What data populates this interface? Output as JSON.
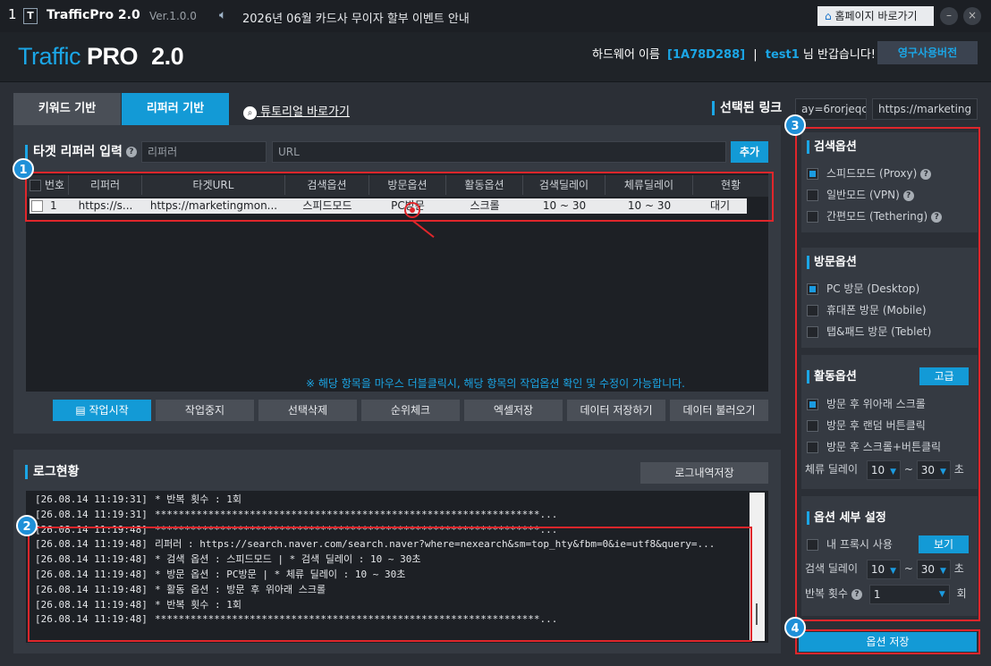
{
  "window": {
    "number": "1",
    "app_name": "TrafficPro 2.0",
    "version": "Ver.1.0.0",
    "notice": "2026년 06월 카드사 무이자 할부 이벤트 안내",
    "home_button": "홈페이지 바로가기"
  },
  "header": {
    "logo_traffic": "Traffic",
    "logo_pro": "PRO",
    "logo_ver": "2.0",
    "hw_label": "하드웨어 이름",
    "hw_id": "[1A78D288]",
    "sep": "|",
    "user": "test1",
    "greet": "님 반갑습니다!",
    "license_button": "영구사용버전"
  },
  "tabs": {
    "keyword": "키워드 기반",
    "referrer": "리퍼러 기반",
    "tutorial": "튜토리얼 바로가기"
  },
  "selected_link": {
    "label": "선택된 링크",
    "field1": "ay=6rorjeqc",
    "field2": "https://marketing"
  },
  "target": {
    "label": "타겟 리퍼러 입력",
    "ref_placeholder": "리퍼러",
    "url_placeholder": "URL",
    "add_button": "추가"
  },
  "table": {
    "headers": [
      "번호",
      "리퍼러",
      "타겟URL",
      "검색옵션",
      "방문옵션",
      "활동옵션",
      "검색딜레이",
      "체류딜레이",
      "현황"
    ],
    "rows": [
      {
        "no": "1",
        "referrer": "https://s...",
        "url": "https://marketingmon...",
        "search": "스피드모드",
        "visit": "PC방문",
        "activity": "스크롤",
        "search_delay": "10 ~ 30",
        "stay_delay": "10 ~ 30",
        "status": "대기"
      }
    ],
    "hint": "※ 해당 항목을 마우스 더블클릭시, 해당 항목의 작업옵션 확인 및 수정이 가능합니다."
  },
  "actions": {
    "start": "작업시작",
    "stop": "작업중지",
    "delete": "선택삭제",
    "rank": "순위체크",
    "excel": "엑셀저장",
    "save_data": "데이터 저장하기",
    "load_data": "데이터 불러오기"
  },
  "log": {
    "title": "로그현황",
    "save_button": "로그내역저장",
    "lines": [
      {
        "time": "[26.08.14 11:19:31]",
        "msg": "* 반복 횟수 : 1회"
      },
      {
        "time": "[26.08.14 11:19:31]",
        "msg": "*****************************************************************..."
      },
      {
        "time": "[26.08.14 11:19:48]",
        "msg": "*****************************************************************..."
      },
      {
        "time": "[26.08.14 11:19:48]",
        "msg": "리퍼러 : https://search.naver.com/search.naver?where=nexearch&sm=top_hty&fbm=0&ie=utf8&query=..."
      },
      {
        "time": "[26.08.14 11:19:48]",
        "msg": "* 검색 옵션 : 스피드모드 | * 검색 딜레이 : 10 ~ 30초"
      },
      {
        "time": "[26.08.14 11:19:48]",
        "msg": "* 방문 옵션 : PC방문 | * 체류 딜레이 : 10 ~ 30초"
      },
      {
        "time": "[26.08.14 11:19:48]",
        "msg": "* 활동 옵션 : 방문 후 위아래 스크롤"
      },
      {
        "time": "[26.08.14 11:19:48]",
        "msg": "* 반복 횟수 : 1회"
      },
      {
        "time": "[26.08.14 11:19:48]",
        "msg": "*****************************************************************..."
      }
    ]
  },
  "badges": [
    "1",
    "2",
    "3",
    "4"
  ],
  "options": {
    "search": {
      "title": "검색옵션",
      "items": [
        {
          "label": "스피드모드 (Proxy)",
          "checked": true
        },
        {
          "label": "일반모드 (VPN)",
          "checked": false
        },
        {
          "label": "간편모드 (Tethering)",
          "checked": false
        }
      ]
    },
    "visit": {
      "title": "방문옵션",
      "items": [
        {
          "label": "PC 방문 (Desktop)",
          "checked": true
        },
        {
          "label": "휴대폰 방문 (Mobile)",
          "checked": false
        },
        {
          "label": "탭&패드 방문 (Teblet)",
          "checked": false
        }
      ]
    },
    "activity": {
      "title": "활동옵션",
      "advanced": "고급",
      "items": [
        {
          "label": "방문 후 위아래 스크롤",
          "checked": true
        },
        {
          "label": "방문 후 랜덤 버튼클릭",
          "checked": false
        },
        {
          "label": "방문 후 스크롤+버튼클릭",
          "checked": false
        }
      ],
      "stay_label": "체류 딜레이",
      "stay_min": "10",
      "stay_max": "30",
      "tilde": "~",
      "unit": "초"
    },
    "detail": {
      "title": "옵션 세부 설정",
      "proxy_label": "내 프록시 사용",
      "view_button": "보기",
      "search_delay_label": "검색 딜레이",
      "sd_min": "10",
      "sd_max": "30",
      "tilde": "~",
      "unit": "초",
      "repeat_label": "반복 횟수",
      "repeat_value": "1",
      "repeat_unit": "회"
    },
    "save_button": "옵션 저장"
  },
  "colors": {
    "accent": "#139ad6",
    "highlight": "#e0262b"
  }
}
